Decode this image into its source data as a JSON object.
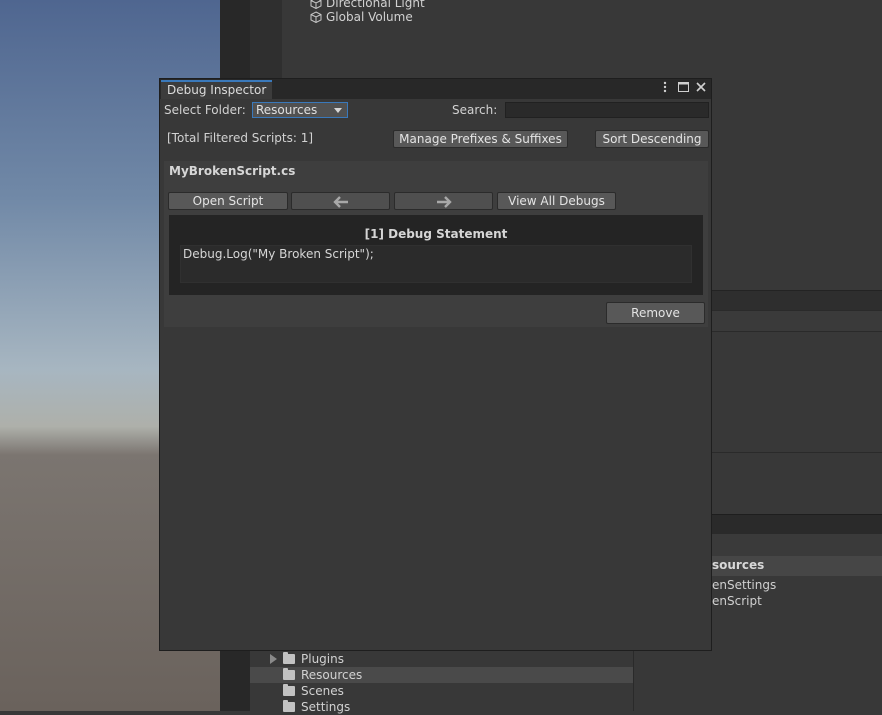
{
  "hierarchy": {
    "items": [
      "Directional Light",
      "Global Volume"
    ]
  },
  "window": {
    "tab_title": "Debug Inspector",
    "select_folder_label": "Select Folder:",
    "folder_selected": "Resources",
    "search_label": "Search:",
    "search_value": "",
    "total_filtered": "[Total Filtered Scripts: 1]",
    "manage_button": "Manage Prefixes & Suffixes",
    "sort_button": "Sort Descending",
    "script_name": "MyBrokenScript.cs",
    "open_script_button": "Open Script",
    "view_all_button": "View All Debugs",
    "statement_header": "[1] Debug Statement",
    "statement_code": "Debug.Log(\"My Broken Script\");",
    "remove_button": "Remove"
  },
  "project": {
    "folders": [
      {
        "label": "Plugins",
        "expandable": true,
        "selected": false
      },
      {
        "label": "Resources",
        "expandable": false,
        "selected": true
      },
      {
        "label": "Scenes",
        "expandable": false,
        "selected": false
      },
      {
        "label": "Settings",
        "expandable": false,
        "selected": false
      }
    ]
  },
  "right_panel": {
    "title": "sources",
    "files": [
      "enSettings",
      "enScript"
    ]
  },
  "colors": {
    "accent": "#3a79bb",
    "window_bg": "#383838"
  }
}
